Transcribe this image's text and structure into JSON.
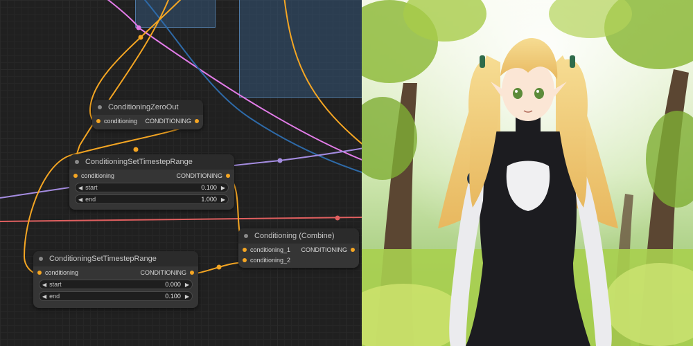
{
  "nodes": {
    "zero_out": {
      "title": "ConditioningZeroOut",
      "input_label": "conditioning",
      "output_label": "CONDITIONING"
    },
    "range_top": {
      "title": "ConditioningSetTimestepRange",
      "input_label": "conditioning",
      "output_label": "CONDITIONING",
      "start_label": "start",
      "start_value": "0.100",
      "end_label": "end",
      "end_value": "1.000"
    },
    "range_bottom": {
      "title": "ConditioningSetTimestepRange",
      "input_label": "conditioning",
      "output_label": "CONDITIONING",
      "start_label": "start",
      "start_value": "0.000",
      "end_label": "end",
      "end_value": "0.100"
    },
    "combine": {
      "title": "Conditioning (Combine)",
      "input1_label": "conditioning_1",
      "input2_label": "conditioning_2",
      "output_label": "CONDITIONING"
    }
  },
  "colors": {
    "conditioning_wire": "#f5a623",
    "pink_wire": "#e27ce8",
    "blue_wire": "#2e6aa8",
    "lavender_wire": "#a48ce0",
    "red_wire": "#e05f5f",
    "group_fill": "#345678"
  },
  "icons": {
    "decrement": "left-triangle",
    "increment": "right-triangle"
  }
}
